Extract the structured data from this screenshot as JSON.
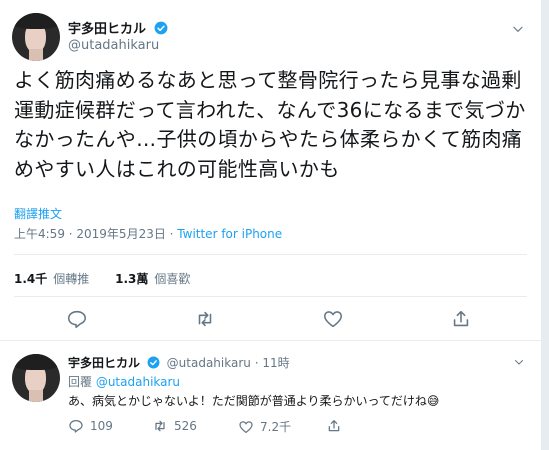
{
  "main": {
    "display_name": "宇多田ヒカル",
    "handle": "@utadahikaru",
    "text": "よく筋肉痛めるなあと思って整骨院行ったら見事な過剰\n運動症候群だって言われた、なんで36になるまで気づか\nなかったんや…子供の頃からやたら体柔らかくて筋肉痛\nめやすい人はこれの可能性高いかも",
    "translate": "翻譯推文",
    "time": "上午4:59 · 2019年5月23日 · ",
    "source": "Twitter for iPhone",
    "retweets_count": "1.4千",
    "retweets_label": "個轉推",
    "likes_count": "1.3萬",
    "likes_label": "個喜歡"
  },
  "reply": {
    "display_name": "宇多田ヒカル",
    "handle_time": "@utadahikaru · 11時",
    "replying_prefix": "回覆 ",
    "replying_to": "@utadahikaru",
    "text": "あ、病気とかじゃないよ！ただ関節が普通より柔らかいってだけね😅",
    "replies": "109",
    "retweets": "526",
    "likes": "7.2千"
  },
  "colors": {
    "accent": "#1da1f2",
    "muted": "#657786",
    "text": "#14171a"
  },
  "icons": [
    "verified-badge-icon",
    "chevron-down-icon",
    "reply-icon",
    "retweet-icon",
    "like-icon",
    "share-icon"
  ]
}
